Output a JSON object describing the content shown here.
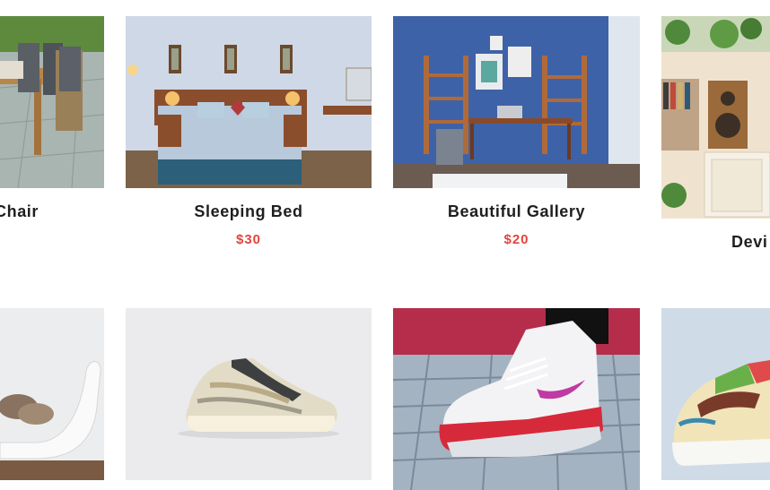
{
  "products": [
    {
      "title": "Chair",
      "price": "",
      "image": "patio-chair-image"
    },
    {
      "title": "Sleeping Bed",
      "price": "$30",
      "image": "bedroom-image"
    },
    {
      "title": "Beautiful Gallery",
      "price": "$20",
      "image": "office-gallery-image"
    },
    {
      "title": "Devi",
      "price": "",
      "image": "speaker-shelf-image"
    },
    {
      "title": "",
      "price": "",
      "image": "white-lounge-chair-image"
    },
    {
      "title": "",
      "price": "",
      "image": "beige-sneaker-image"
    },
    {
      "title": "",
      "price": "",
      "image": "red-sneaker-image"
    },
    {
      "title": "",
      "price": "",
      "image": "colorful-sneaker-image"
    }
  ],
  "colors": {
    "price": "#e2443e",
    "title": "#1f1f1f"
  }
}
